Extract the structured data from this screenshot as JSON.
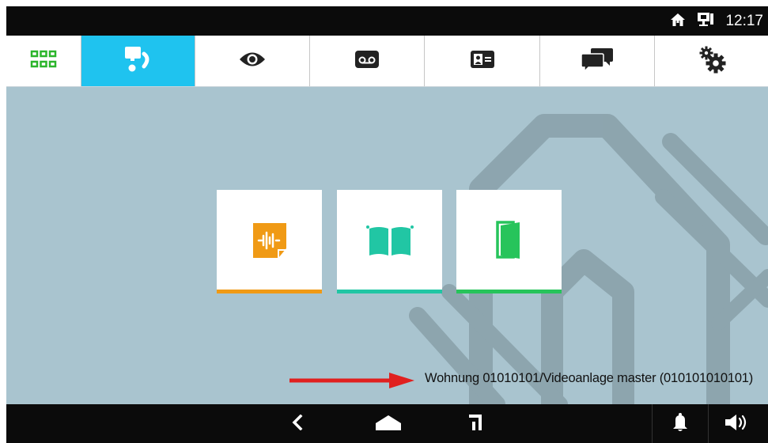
{
  "status": {
    "time": "12:17",
    "icons": [
      "home-icon",
      "network-icon"
    ]
  },
  "topnav": {
    "tabs": [
      {
        "icon": "grid-icon",
        "active": false
      },
      {
        "icon": "intercom-call-icon",
        "active": true
      },
      {
        "icon": "eye-icon",
        "active": false
      },
      {
        "icon": "voicemail-icon",
        "active": false
      },
      {
        "icon": "contact-card-icon",
        "active": false
      },
      {
        "icon": "chat-icon",
        "active": false
      },
      {
        "icon": "settings-gears-icon",
        "active": false
      }
    ]
  },
  "tiles": [
    {
      "icon": "audio-note-icon",
      "color": "#f09a15"
    },
    {
      "icon": "gate-icon",
      "color": "#21c6a4"
    },
    {
      "icon": "door-icon",
      "color": "#27c45b"
    }
  ],
  "info": {
    "text": "Wohnung 01010101/Videoanlage master (010101010101)"
  },
  "bottombar": {
    "icons": [
      "back-icon",
      "home-nav-icon",
      "recent-apps-icon",
      "bell-icon",
      "volume-icon"
    ]
  },
  "colors": {
    "accent": "#1fc3ef",
    "background": "#a9c4cf",
    "grid_green": "#2bb52b",
    "arrow_red": "#e0201f"
  }
}
